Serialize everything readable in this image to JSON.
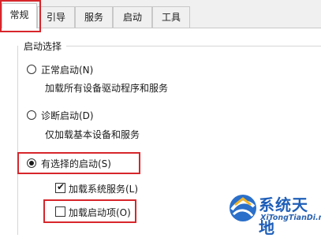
{
  "tabs": [
    {
      "label": "常规",
      "active": true
    },
    {
      "label": "引导",
      "active": false
    },
    {
      "label": "服务",
      "active": false
    },
    {
      "label": "启动",
      "active": false
    },
    {
      "label": "工具",
      "active": false
    }
  ],
  "group": {
    "title": "启动选择"
  },
  "options": {
    "normal": {
      "label": "正常启动(N)",
      "description": "加载所有设备驱动程序和服务",
      "selected": false
    },
    "diagnostic": {
      "label": "诊断启动(D)",
      "description": "仅加载基本设备和服务",
      "selected": false
    },
    "selective": {
      "label": "有选择的启动(S)",
      "selected": true
    }
  },
  "checkboxes": {
    "load_services": {
      "label": "加载系统服务(L)",
      "checked": true
    },
    "load_startup": {
      "label": "加载启动项(O)",
      "checked": false
    }
  },
  "highlight_color": "#d7262b",
  "watermark": {
    "text_cn": "系统天地",
    "text_en": "XiTongTianDi.net",
    "icon": "globe-logo-icon"
  }
}
